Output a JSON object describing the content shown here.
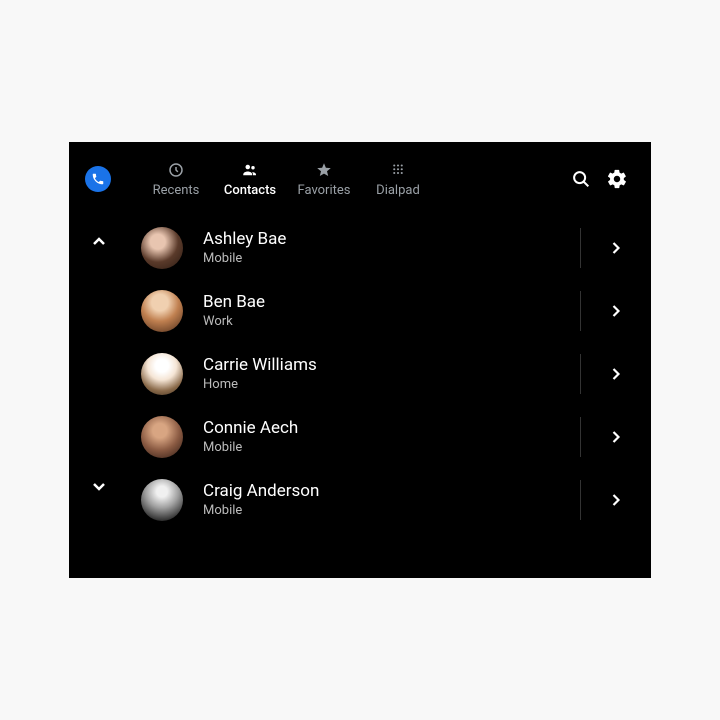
{
  "tabs": {
    "recents": "Recents",
    "contacts": "Contacts",
    "favorites": "Favorites",
    "dialpad": "Dialpad"
  },
  "activeTab": "contacts",
  "contacts": [
    {
      "name": "Ashley Bae",
      "type": "Mobile"
    },
    {
      "name": "Ben Bae",
      "type": "Work"
    },
    {
      "name": "Carrie Williams",
      "type": "Home"
    },
    {
      "name": "Connie Aech",
      "type": "Mobile"
    },
    {
      "name": "Craig Anderson",
      "type": "Mobile"
    }
  ]
}
